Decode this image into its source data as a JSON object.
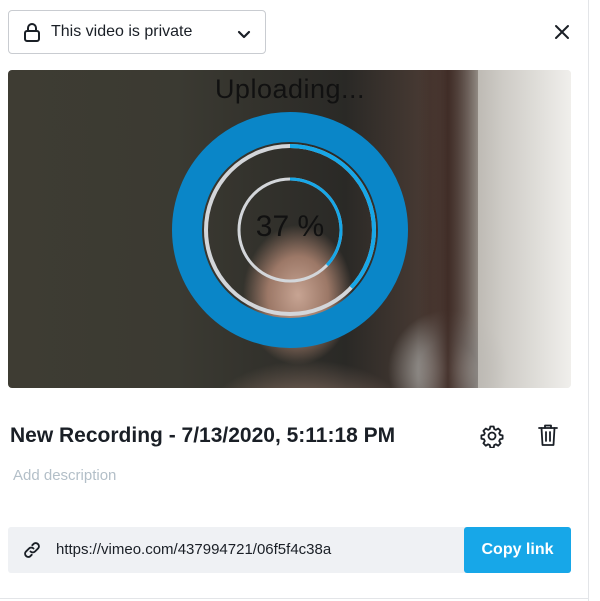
{
  "privacy": {
    "label": "This video is private",
    "icon": "lock-icon",
    "dropdown_icon": "chevron-down-icon"
  },
  "close": {
    "icon": "close-icon"
  },
  "upload": {
    "status_text": "Uploading...",
    "percent_text": "37 %",
    "progress": 0.37
  },
  "video": {
    "title": "New Recording - 7/13/2020, 5:11:18 PM",
    "description_placeholder": "Add description",
    "settings_icon": "gear-icon",
    "delete_icon": "trash-icon"
  },
  "share": {
    "link_icon": "link-icon",
    "url": "https://vimeo.com/437994721/06f5f4c38a",
    "copy_label": "Copy link"
  },
  "colors": {
    "accent": "#17a7e8",
    "ring_outer": "#0a86c8",
    "ring_progress": "#17a7e8",
    "ring_track": "#d3d6da",
    "text_primary": "#1a1f26",
    "placeholder": "#b3bfc8",
    "link_bar_bg": "#eff1f4"
  }
}
